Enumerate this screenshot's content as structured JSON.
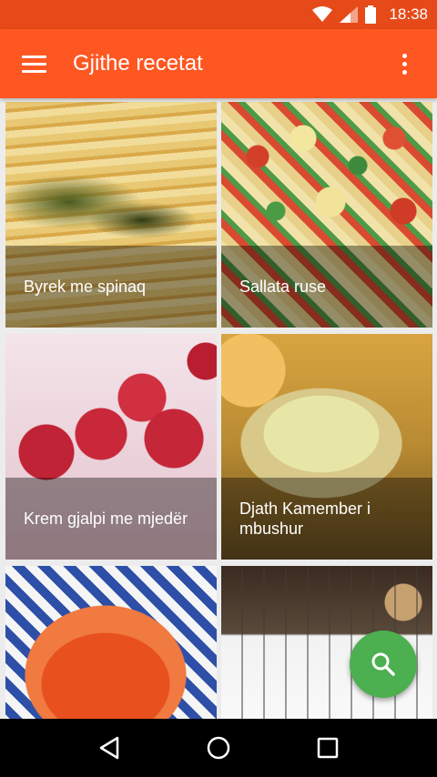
{
  "status_bar": {
    "time": "18:38"
  },
  "app_bar": {
    "title": "Gjithe recetat"
  },
  "recipes": [
    {
      "name": "Byrek me spinaq",
      "image": "byrek-photo"
    },
    {
      "name": "Sallata ruse",
      "image": "salad-photo"
    },
    {
      "name": "Krem gjalpi me mjedër",
      "image": "raspberry-cream-photo"
    },
    {
      "name": "Djath Kamember i mbushur",
      "image": "camembert-photo"
    },
    {
      "name": "",
      "image": "jam-jar-photo"
    },
    {
      "name": "",
      "image": "cookies-photo"
    }
  ],
  "fab": {
    "icon": "search-icon",
    "color": "#4caf50"
  },
  "colors": {
    "primary": "#ff5722",
    "primary_dark": "#e64a19",
    "accent": "#4caf50"
  }
}
